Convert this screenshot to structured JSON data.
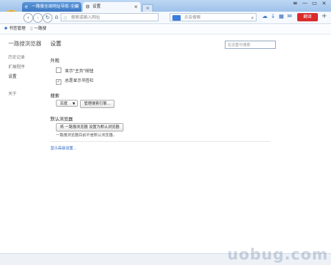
{
  "tabs": [
    {
      "label": "一路搜全球网址导航-全网",
      "icon": "e",
      "close": "×",
      "active": true
    },
    {
      "label": "设置",
      "icon": "⚙",
      "close": "×",
      "active": false
    }
  ],
  "new_tab_label": "+",
  "window_controls": [
    "≡",
    "—",
    "▭",
    "×"
  ],
  "toolbar": {
    "address_placeholder": "搜索或输入网址",
    "search_placeholder": "点击搜索",
    "translate_label": "翻译",
    "add_label": "+"
  },
  "bookmarks": [
    {
      "label": "书签管理"
    },
    {
      "label": "一路搜"
    }
  ],
  "sidebar": {
    "title": "一路搜浏览器",
    "items": [
      "历史记录",
      "扩展程序",
      "设置",
      "关于"
    ]
  },
  "main": {
    "title": "设置",
    "search_placeholder": "在设置中搜索",
    "appearance": {
      "heading": "外观",
      "show_home_button": "显示\"主页\"按钮",
      "show_bookmark_bar": "总是显示书签栏"
    },
    "search": {
      "heading": "搜索",
      "engine": "百度",
      "manage_button": "管理搜索引擎..."
    },
    "default_browser": {
      "heading": "默认浏览器",
      "set_default_button": "将 一路搜浏览器 设置为默认浏览器",
      "note": "一路搜浏览器目前不是默认浏览器。"
    },
    "advanced_link": "显示高级设置..."
  },
  "watermark": "uobug.com",
  "colors": {
    "accent": "#2a64c2",
    "translate": "#d92b2b",
    "tab_active": "#3d78c4"
  }
}
